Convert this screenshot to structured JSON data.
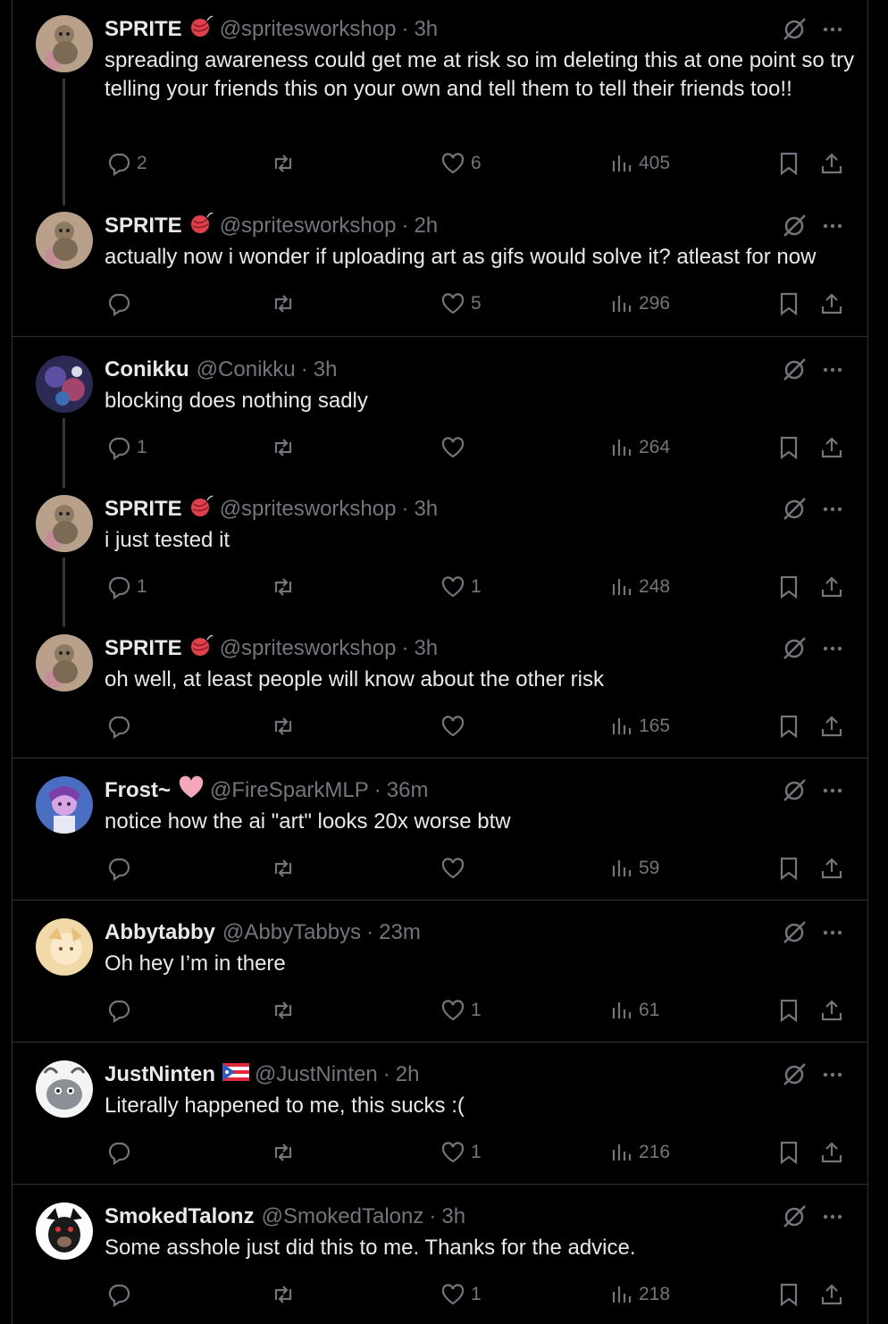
{
  "colors": {
    "background": "#000000",
    "text": "#e7e9ea",
    "muted": "#71767b",
    "divider": "#2f3336"
  },
  "posts": [
    {
      "name": "SPRITE",
      "badge": "yarn-ball-icon",
      "handle": "@spritesworkshop",
      "dot": "·",
      "time": "3h",
      "text": "spreading awareness could get me at risk so im deleting this at one point so try telling your friends this on your own  and tell them to tell their friends too!!",
      "replies": "2",
      "reposts": "",
      "likes": "6",
      "views": "405"
    },
    {
      "name": "SPRITE",
      "badge": "yarn-ball-icon",
      "handle": "@spritesworkshop",
      "dot": "·",
      "time": "2h",
      "text": "actually now i wonder if uploading art as gifs would solve it? atleast for now",
      "replies": "",
      "reposts": "",
      "likes": "5",
      "views": "296"
    },
    {
      "name": "Conikku",
      "badge": "",
      "handle": "@Conikku",
      "dot": "·",
      "time": "3h",
      "text": "blocking does nothing sadly",
      "replies": "1",
      "reposts": "",
      "likes": "",
      "views": "264"
    },
    {
      "name": "SPRITE",
      "badge": "yarn-ball-icon",
      "handle": "@spritesworkshop",
      "dot": "·",
      "time": "3h",
      "text": "i just tested it",
      "replies": "1",
      "reposts": "",
      "likes": "1",
      "views": "248"
    },
    {
      "name": "SPRITE",
      "badge": "yarn-ball-icon",
      "handle": "@spritesworkshop",
      "dot": "·",
      "time": "3h",
      "text": "oh well, at least people will know about the other risk",
      "replies": "",
      "reposts": "",
      "likes": "",
      "views": "165"
    },
    {
      "name": "Frost~",
      "badge": "pink-heart-icon",
      "handle": "@FireSparkMLP",
      "dot": "·",
      "time": "36m",
      "text": "notice how the ai \"art\" looks 20x worse btw",
      "replies": "",
      "reposts": "",
      "likes": "",
      "views": "59"
    },
    {
      "name": "Abbytabby",
      "badge": "",
      "handle": "@AbbyTabbys",
      "dot": "·",
      "time": "23m",
      "text": "Oh hey I’m in there",
      "replies": "",
      "reposts": "",
      "likes": "1",
      "views": "61"
    },
    {
      "name": "JustNinten",
      "badge": "puerto-rico-flag-icon",
      "handle": "@JustNinten",
      "dot": "·",
      "time": "2h",
      "text": "Literally happened to me, this sucks :(",
      "replies": "",
      "reposts": "",
      "likes": "1",
      "views": "216"
    },
    {
      "name": "SmokedTalonz",
      "badge": "",
      "handle": "@SmokedTalonz",
      "dot": "·",
      "time": "3h",
      "text": "Some asshole just did this to me. Thanks for the advice.",
      "replies": "",
      "reposts": "",
      "likes": "1",
      "views": "218"
    }
  ]
}
